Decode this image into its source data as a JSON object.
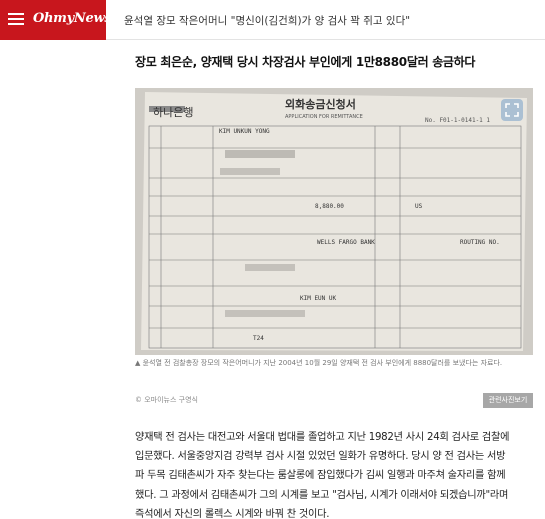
{
  "header": {
    "logo": "OhmyNews",
    "headline": "윤석열 장모 작은어머니 \"명신이(김건희)가 양 검사 꽉 쥐고 있다\""
  },
  "article": {
    "subtitle": "장모 최은순, 양재택 당시 차장검사 부인에게 1만8880달러 송금하다",
    "photo": {
      "bank_name": "하나은행",
      "form_title_ko": "외화송금신청서",
      "form_title_en": "APPLICATION FOR REMITTANCE",
      "form_no": "No. F01-1-0141-1 1",
      "applicant_name": "KIM UNKUN YONG",
      "bank_field": "WELLS FARGO BANK",
      "routing": "ROUTING NO.",
      "beneficiary": "KIM EUN UK",
      "amount_digits": "8,880.00",
      "currency": "US",
      "date_mark": "T24"
    },
    "caption": "▲  윤석열 전 검찰총장 장모의 작은어머니가 지난 2004년 10월 29일 양재택 전 검사 부인에게 8880달러를 보냈다는 자료다.",
    "credit": "© 오마이뉴스 구영식",
    "related_button": "관련사진보기",
    "paragraph_lines": [
      "양재택 전 검사는 대전고와 서울대 법대를 졸업하고 지난 1982년 사시 24회 검사로 검찰에",
      "입문했다. 서울중앙지검 강력부 검사 시절 있었던 일화가 유명하다. 당시 양 전 검사는 서방",
      "파 두목 김태촌씨가 자주 찾는다는 룸살롱에 잠입했다가 김씨 일행과 마주쳐 술자리를 함께",
      "했다. 그 과정에서 김태촌씨가 그의 시계를 보고 \"검사님, 시계가 이래서야 되겠습니까\"라며",
      "즉석에서 자신의 롤렉스 시계와 바꿔 찬 것이다."
    ]
  }
}
